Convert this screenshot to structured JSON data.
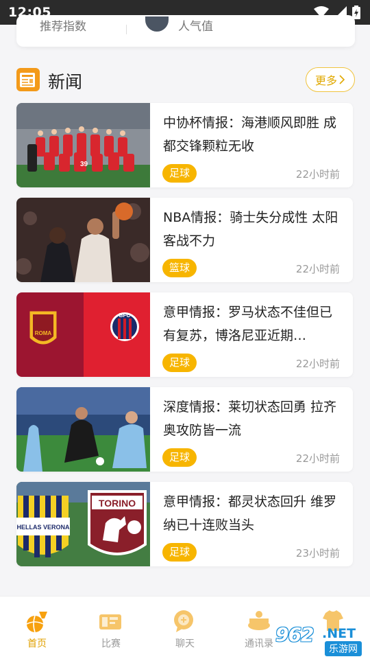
{
  "status_bar": {
    "time": "12:05"
  },
  "previous_card": {
    "left_text": "推荐指数",
    "right_text": "人气值"
  },
  "news_section": {
    "title": "新闻",
    "more_label": "更多"
  },
  "news": [
    {
      "title": "中协杯情报：海港顺风即胜 成都交锋颗粒无收",
      "tag": "足球",
      "time": "22小时前",
      "thumb": "team-photo"
    },
    {
      "title": "NBA情报：骑士失分成性 太阳客战不力",
      "tag": "篮球",
      "time": "22小时前",
      "thumb": "basketball-player"
    },
    {
      "title": "意甲情报：罗马状态不佳但已有复苏，博洛尼亚近期…",
      "tag": "足球",
      "time": "22小时前",
      "thumb": "roma-vs-bologna",
      "badges": [
        "ROMA",
        "BFC"
      ]
    },
    {
      "title": "深度情报：莱切状态回勇 拉齐奥攻防皆一流",
      "tag": "足球",
      "time": "22小时前",
      "thumb": "soccer-action"
    },
    {
      "title": "意甲情报：都灵状态回升 维罗纳已十连败当头",
      "tag": "足球",
      "time": "23小时前",
      "thumb": "verona-vs-torino",
      "badges": [
        "HELLAS VERONA",
        "TORINO"
      ]
    }
  ],
  "tabbar": [
    {
      "label": "首页",
      "icon": "basketball-hoop-icon",
      "active": true
    },
    {
      "label": "比赛",
      "icon": "match-ticket-icon",
      "active": false
    },
    {
      "label": "聊天",
      "icon": "chat-bubble-icon",
      "active": false
    },
    {
      "label": "通讯录",
      "icon": "contacts-stage-icon",
      "active": false
    },
    {
      "label": "",
      "icon": "jersey-icon",
      "active": false
    }
  ],
  "watermark": {
    "number": "962",
    "suffix": ".NET",
    "text": "乐游网"
  },
  "colors": {
    "accent": "#f7b500",
    "accent_text": "#e0a000",
    "status_bar": "#2b2b2b"
  }
}
